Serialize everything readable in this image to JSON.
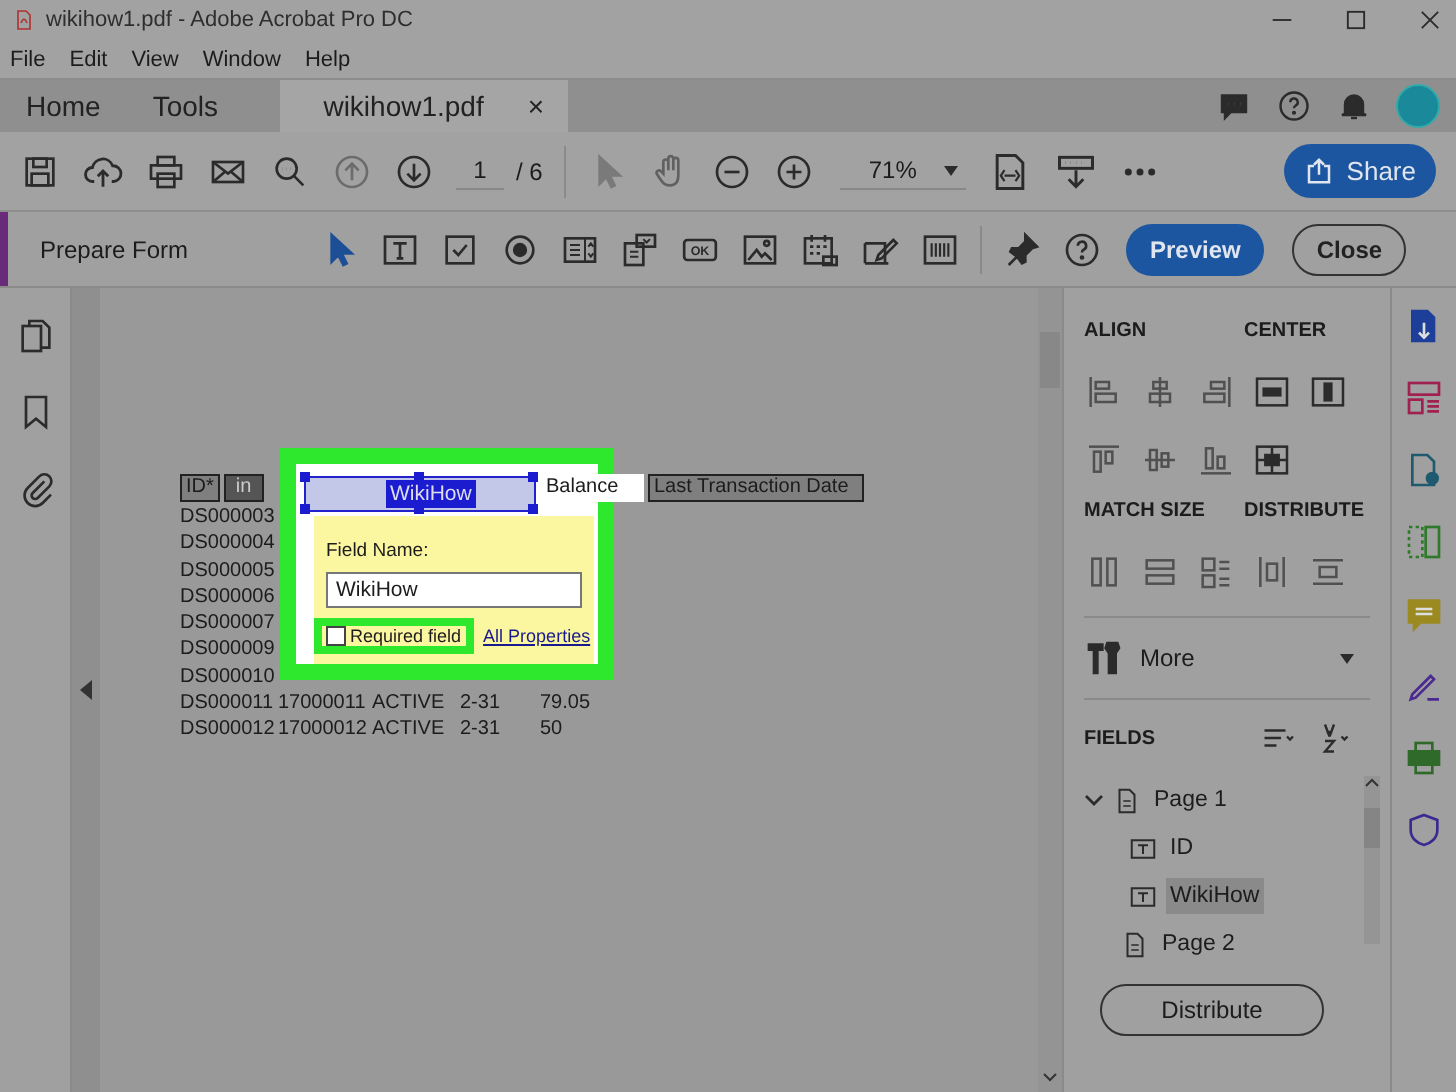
{
  "window": {
    "title": "wikihow1.pdf - Adobe Acrobat Pro DC"
  },
  "menu": [
    "File",
    "Edit",
    "View",
    "Window",
    "Help"
  ],
  "tabs": [
    {
      "label": "Home",
      "selected": false
    },
    {
      "label": "Tools",
      "selected": false
    },
    {
      "label": "wikihow1.pdf",
      "selected": true,
      "close": "×"
    }
  ],
  "toolbar": {
    "page": "1",
    "page_total": "/ 6",
    "zoom": "71%",
    "share": "Share"
  },
  "form_bar": {
    "title": "Prepare Form",
    "button_tool_label": "OK",
    "preview": "Preview",
    "close": "Close"
  },
  "document": {
    "header": [
      "ID*",
      "in",
      "Balance",
      "Last Transaction Date"
    ],
    "rows": [
      [
        "DS000003"
      ],
      [
        "DS000004"
      ],
      [
        "DS000005"
      ],
      [
        "DS000006"
      ],
      [
        "DS000007"
      ],
      [
        "DS000009"
      ],
      [
        "DS000010"
      ],
      [
        "DS000011",
        "17000011",
        "ACTIVE",
        "2-31",
        "79.05"
      ],
      [
        "DS000012",
        "17000012",
        "ACTIVE",
        "2-31",
        "50"
      ]
    ],
    "field": {
      "label": "WikiHow"
    },
    "popup": {
      "label": "Field Name:",
      "value": "WikiHow",
      "required": {
        "label": "Required field",
        "checked": false
      },
      "link": "All Properties"
    }
  },
  "panel": {
    "align": "ALIGN",
    "center": "CENTER",
    "match_size": "MATCH SIZE",
    "distribute": "DISTRIBUTE",
    "more": "More",
    "fields": "FIELDS",
    "tree": [
      {
        "label": "Page 1",
        "expanded": true,
        "selected": false,
        "children": [
          {
            "label": "ID",
            "selected": false
          },
          {
            "label": "WikiHow",
            "selected": true
          }
        ]
      },
      {
        "label": "Page 2",
        "expanded": false,
        "selected": false
      }
    ],
    "button": "Distribute"
  }
}
